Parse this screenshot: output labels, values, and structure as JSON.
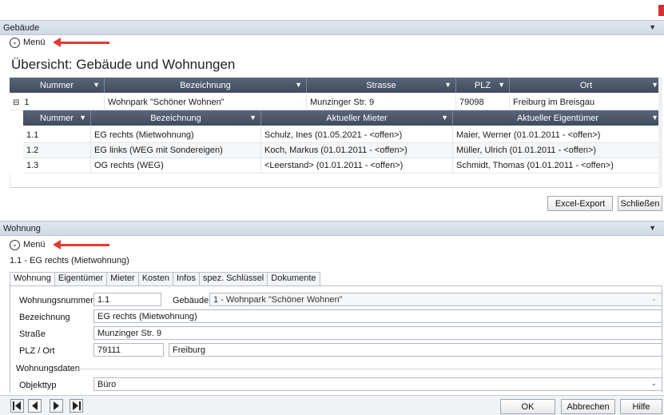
{
  "top_panel": {
    "title": "Gebäude"
  },
  "top_menu": {
    "label": "Menü"
  },
  "overview_title": "Übersicht: Gebäude und Wohnungen",
  "building_grid": {
    "columns": [
      "Nummer",
      "Bezeichnung",
      "Strasse",
      "PLZ",
      "Ort"
    ],
    "rows": [
      {
        "expander": "⊟",
        "nummer": "1",
        "bezeichnung": "Wohnpark \"Schöner Wohnen\"",
        "strasse": "Munzinger Str. 9",
        "plz": "79098",
        "ort": "Freiburg im Breisgau"
      }
    ]
  },
  "unit_grid": {
    "columns": [
      "Nummer",
      "Bezeichnung",
      "Aktueller Mieter",
      "Aktueller Eigentümer"
    ],
    "rows": [
      {
        "nummer": "1.1",
        "bezeichnung": "EG rechts (Mietwohnung)",
        "mieter": "Schulz, Ines (01.05.2021 - <offen>)",
        "eigentuemer": "Maier, Werner (01.01.2011 - <offen>)"
      },
      {
        "nummer": "1.2",
        "bezeichnung": "EG links (WEG mit Sondereigen)",
        "mieter": "Koch, Markus (01.01.2011 - <offen>)",
        "eigentuemer": "Müller, Ulrich (01.01.2011 - <offen>)"
      },
      {
        "nummer": "1.3",
        "bezeichnung": "OG rechts (WEG)",
        "mieter": "<Leerstand> (01.01.2011 - <offen>)",
        "eigentuemer": "Schmidt, Thomas (01.01.2011 - <offen>)"
      }
    ]
  },
  "top_buttons": {
    "excel_export": "Excel-Export",
    "close": "Schließen"
  },
  "bottom_panel": {
    "title": "Wohnung"
  },
  "bottom_menu": {
    "label": "Menü"
  },
  "record_caption": "1.1 - EG rechts (Mietwohnung)",
  "tabs": [
    "Wohnung",
    "Eigentümer",
    "Mieter",
    "Kosten",
    "Infos",
    "spez. Schlüssel",
    "Dokumente"
  ],
  "form": {
    "wohnungsnummer_label": "Wohnungsnummer",
    "wohnungsnummer_value": "1.1",
    "gebaeude_label": "Gebäude",
    "gebaeude_value": "1 - Wohnpark \"Schöner Wohnen\"",
    "bezeichnung_label": "Bezeichnung",
    "bezeichnung_value": "EG rechts (Mietwohnung)",
    "strasse_label": "Straße",
    "strasse_value": "Munzinger Str. 9",
    "plz_ort_label": "PLZ / Ort",
    "plz_value": "79111",
    "ort_value": "Freiburg",
    "section_label": "Wohnungsdaten",
    "objekttyp_label": "Objekttyp",
    "objekttyp_value": "Büro"
  },
  "bottom_buttons": {
    "ok": "OK",
    "cancel": "Abbrechen",
    "help": "Hilfe"
  },
  "colors": {
    "grid_header": "#4a5668",
    "arrow": "#e53935",
    "panel_header": "#d6dee8"
  }
}
